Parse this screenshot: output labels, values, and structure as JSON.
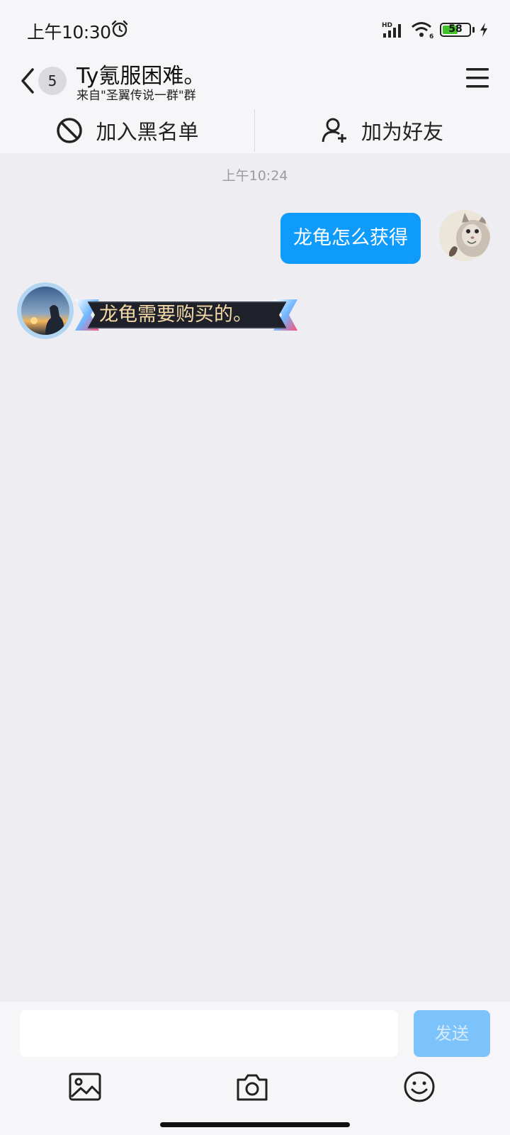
{
  "status_bar": {
    "time": "上午10:30",
    "network_label": "HD",
    "wifi_label": "6",
    "battery_level": "58",
    "battery_percent": 58,
    "battery_color": "#42c12b"
  },
  "header": {
    "unread_count": "5",
    "title": "Ty氪服困难。",
    "subtitle": "来自\"圣翼传说一群\"群"
  },
  "actions": {
    "blacklist_label": "加入黑名单",
    "add_friend_label": "加为好友"
  },
  "messages": {
    "timestamp": "上午10:24",
    "items": [
      {
        "direction": "outgoing",
        "text": "龙龟怎么获得",
        "bubble_color": "#0f9bfb"
      },
      {
        "direction": "incoming",
        "text": "龙龟需要购买的。",
        "bubble_style": "dark-banner"
      }
    ]
  },
  "input": {
    "placeholder": "",
    "value": "",
    "send_label": "发送"
  },
  "icons": {
    "back": "chevron-left-icon",
    "menu": "hamburger-menu-icon",
    "blacklist": "block-icon",
    "add_friend": "add-user-icon",
    "image": "image-icon",
    "camera": "camera-icon",
    "emoji": "emoji-icon"
  }
}
